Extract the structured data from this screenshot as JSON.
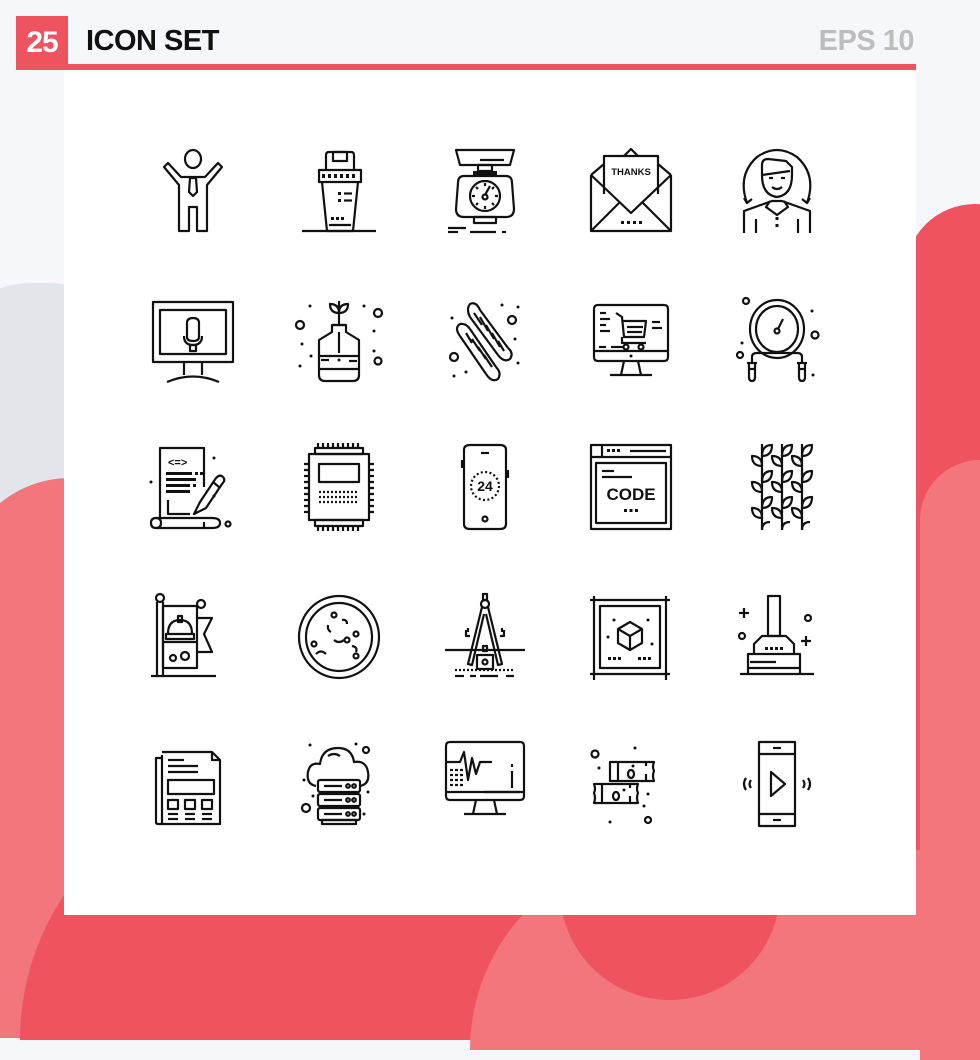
{
  "header": {
    "count": "25",
    "title": "ICON SET",
    "format": "EPS 10"
  },
  "colors": {
    "accent": "#ee535f",
    "accent_light": "#f2767c",
    "gray_shape": "#e2e5e9",
    "background": "#f6f7fa",
    "format_text": "#bdbdbd",
    "icon_stroke": "#111111"
  },
  "icons": [
    {
      "name": "businessman-cheering-icon"
    },
    {
      "name": "trash-bin-icon"
    },
    {
      "name": "kitchen-scale-icon"
    },
    {
      "name": "thanks-envelope-icon",
      "label": "THANKS"
    },
    {
      "name": "user-avatar-refresh-icon"
    },
    {
      "name": "monitor-microphone-icon"
    },
    {
      "name": "plant-jar-icon"
    },
    {
      "name": "candy-icon"
    },
    {
      "name": "online-shopping-monitor-icon"
    },
    {
      "name": "pressure-gauge-icon"
    },
    {
      "name": "code-document-edit-icon",
      "label": "<=>"
    },
    {
      "name": "processor-chip-icon"
    },
    {
      "name": "mobile-24-hours-icon",
      "label": "24"
    },
    {
      "name": "code-browser-icon",
      "label": "CODE"
    },
    {
      "name": "leaves-pattern-icon"
    },
    {
      "name": "construction-flag-icon"
    },
    {
      "name": "petri-dish-icon"
    },
    {
      "name": "drafting-compass-icon"
    },
    {
      "name": "3d-box-blueprint-icon"
    },
    {
      "name": "plunger-press-icon"
    },
    {
      "name": "newspaper-icon"
    },
    {
      "name": "cloud-server-icon"
    },
    {
      "name": "heartbeat-monitor-icon"
    },
    {
      "name": "bandage-icon"
    },
    {
      "name": "mobile-video-play-icon"
    }
  ]
}
